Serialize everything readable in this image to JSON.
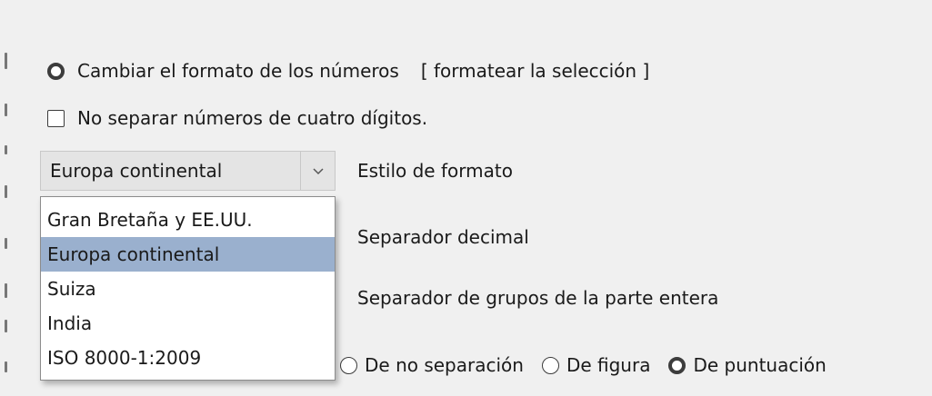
{
  "format_radio": {
    "label": "Cambiar el formato de los números",
    "link": "[ formatear la selección ]",
    "selected": true
  },
  "no_separate_checkbox": {
    "label": "No separar números de cuatro dígitos.",
    "checked": false
  },
  "format_style": {
    "selected_value": "Europa continental",
    "label": "Estilo de formato",
    "options": [
      "Gran Bretaña y EE.UU.",
      "Europa continental",
      "Suiza",
      "India",
      "ISO 8000-1:2009"
    ],
    "highlighted_option": "Europa continental"
  },
  "decimal_separator": {
    "label": "Separador decimal"
  },
  "group_separator": {
    "label": "Separador de grupos de la parte entera"
  },
  "space_type": {
    "options": [
      "De no separación",
      "De figura",
      "De puntuación"
    ],
    "selected": "De puntuación"
  }
}
